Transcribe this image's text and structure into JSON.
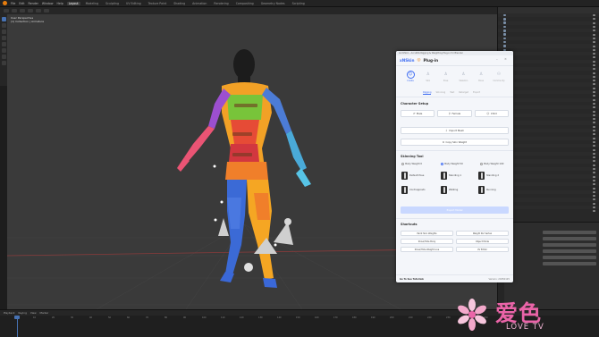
{
  "app": {
    "menus": [
      "File",
      "Edit",
      "Render",
      "Window",
      "Help"
    ],
    "workspaces": [
      "Layout",
      "Modeling",
      "Sculpting",
      "UV Editing",
      "Texture Paint",
      "Shading",
      "Animation",
      "Rendering",
      "Compositing",
      "Geometry Nodes",
      "Scripting"
    ],
    "active_workspace": "Layout"
  },
  "viewport": {
    "info_line1": "User Perspective",
    "info_line2": "(1) Collection | Armature"
  },
  "plugin": {
    "title_bar": "AnimSkin - AccuRIG Rigging & Weighting Plug-in for Blender",
    "brand": "xNSkin",
    "brand_suffix": "Plug-in",
    "window_controls": [
      "–",
      "×"
    ],
    "nav": [
      {
        "label": "Create",
        "icon": "person-icon",
        "active": true
      },
      {
        "label": "Skin",
        "icon": "figure-icon",
        "active": false
      },
      {
        "label": "Pose",
        "icon": "figure-icon",
        "active": false
      },
      {
        "label": "Skeleton",
        "icon": "figure-icon",
        "active": false
      },
      {
        "label": "Bone",
        "icon": "figure-icon",
        "active": false
      },
      {
        "label": "Community",
        "icon": "group-icon",
        "active": false
      }
    ],
    "tabs": [
      {
        "label": "Rigging",
        "active": true
      },
      {
        "label": "Skinning",
        "active": false
      },
      {
        "label": "Test",
        "active": false
      },
      {
        "label": "Retarget",
        "active": false
      },
      {
        "label": "Export",
        "active": false
      }
    ],
    "character_setup": {
      "heading": "Character Setup",
      "gender_buttons": [
        "Male",
        "Female",
        "Child"
      ],
      "import_mesh": "Import Mesh",
      "copy_weight": "Copy Skin Weight"
    },
    "skinning_tool": {
      "heading": "Skinning Tool",
      "options": [
        {
          "label": "Body Weight 0",
          "selected": false
        },
        {
          "label": "Body Weight 50",
          "selected": true
        },
        {
          "label": "Body Weight 100",
          "selected": false
        }
      ],
      "poses": [
        "Default Pose",
        "Standing 1",
        "Standing 2",
        "Contrapposto",
        "Walking",
        "Running"
      ],
      "export_button": "Export Model"
    },
    "shortcuts": {
      "heading": "Shortcuts",
      "buttons": [
        "Paint Skin Weights",
        "Weight Per Vertex",
        "Show/Hide Body",
        "Object Mode",
        "Show/Hide Weight Line",
        "UV Editor"
      ]
    },
    "footer": {
      "tutorial": "Go To See Tutorials",
      "version": "Version: 20250125"
    }
  },
  "timeline": {
    "labels": [
      "Playback",
      "Keying",
      "View",
      "Marker"
    ],
    "ticks": [
      "0",
      "10",
      "20",
      "30",
      "40",
      "50",
      "60",
      "70",
      "80",
      "90",
      "100",
      "110",
      "120",
      "130",
      "140",
      "150",
      "160",
      "170",
      "180",
      "190",
      "200",
      "210",
      "220",
      "230",
      "240",
      "250"
    ]
  },
  "watermark": {
    "cn": "爱色",
    "en": "LOVE TV"
  },
  "colors": {
    "accent": "#3f6df2",
    "blender_orange": "#e87d0d",
    "watermark_pink": "#ea64a8"
  }
}
